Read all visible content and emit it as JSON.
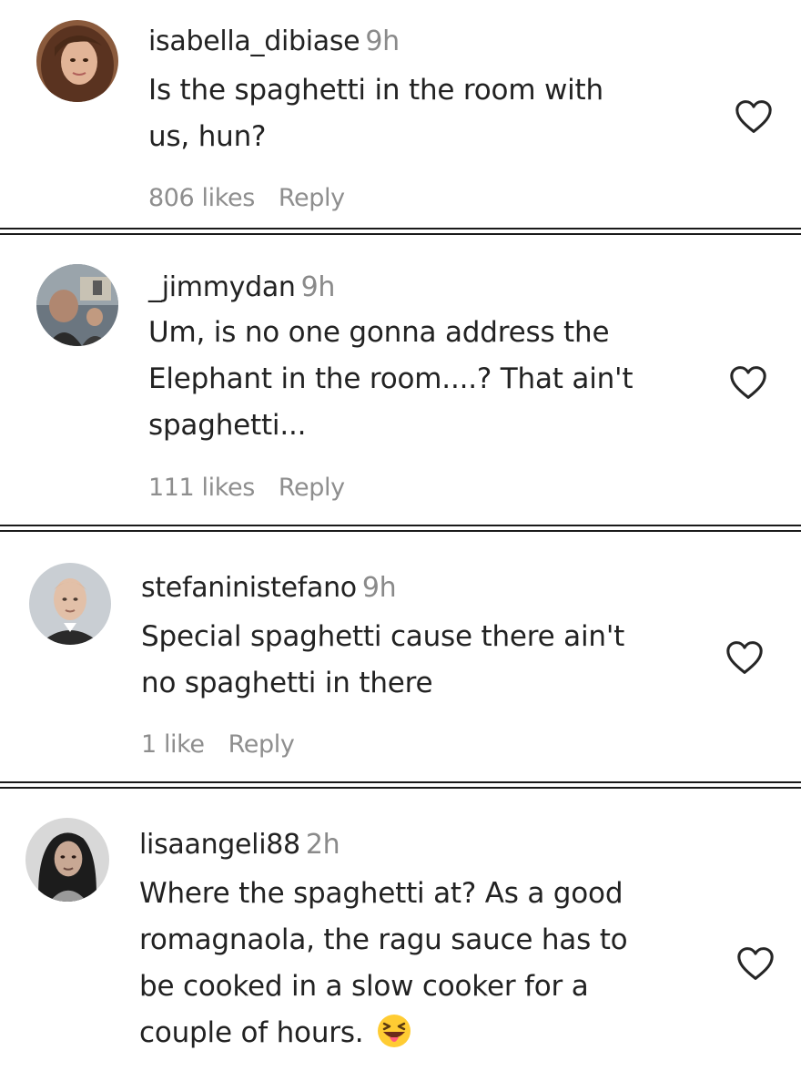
{
  "comments": [
    {
      "username": "isabella_dibiase",
      "time": "9h",
      "lines": [
        "Is the spaghetti in the room with",
        "us, hun?"
      ],
      "likes": "806 likes",
      "reply": "Reply",
      "avatar": "avatar-woman-brown-hair"
    },
    {
      "username": "_jimmydan",
      "time": "9h",
      "lines": [
        "Um, is no one gonna address the",
        "Elephant in the room....? That ain't",
        "spaghetti..."
      ],
      "likes": "111 likes",
      "reply": "Reply",
      "avatar": "avatar-man-photo"
    },
    {
      "username": "stefaninistefano",
      "time": "9h",
      "lines": [
        "Special spaghetti cause there ain't",
        "no spaghetti in there"
      ],
      "likes": "1 like",
      "reply": "Reply",
      "avatar": "avatar-man-bald"
    },
    {
      "username": "lisaangeli88",
      "time": "2h",
      "lines": [
        "Where the spaghetti at? As a good",
        "romagnaola, the ragu sauce has to",
        "be cooked in a slow cooker for a",
        "couple of hours."
      ],
      "emoji": "squinting-face-with-tongue",
      "avatar": "avatar-woman-dark-hair"
    }
  ],
  "colors": {
    "text": "#222222",
    "meta": "#8e8e8e",
    "separator": "#1a1a1a",
    "heart": "#262626"
  },
  "icons": [
    "heart-outline-icon",
    "squinting-face-with-tongue-emoji"
  ]
}
